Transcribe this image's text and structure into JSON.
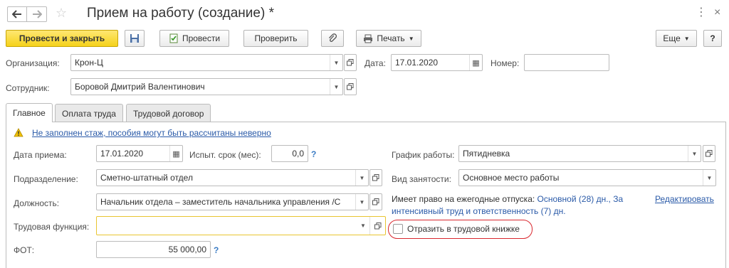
{
  "window": {
    "title": "Прием на работу (создание) *"
  },
  "toolbar": {
    "post_close_label": "Провести и закрыть",
    "post_label": "Провести",
    "check_label": "Проверить",
    "print_label": "Печать",
    "more_label": "Еще",
    "help_label": "?"
  },
  "header": {
    "org_label": "Организация:",
    "org_value": "Крон-Ц",
    "date_label": "Дата:",
    "date_value": "17.01.2020",
    "number_label": "Номер:",
    "number_value": "",
    "employee_label": "Сотрудник:",
    "employee_value": "Боровой Дмитрий Валентинович"
  },
  "tabs": [
    {
      "label": "Главное"
    },
    {
      "label": "Оплата труда"
    },
    {
      "label": "Трудовой договор"
    }
  ],
  "main": {
    "warning_text": "Не заполнен стаж, пособия могут быть рассчитаны неверно",
    "hire_date_label": "Дата приема:",
    "hire_date_value": "17.01.2020",
    "probation_label": "Испыт. срок (мес):",
    "probation_value": "0,0",
    "question_mark": "?",
    "department_label": "Подразделение:",
    "department_value": "Сметно-штатный отдел",
    "position_label": "Должность:",
    "position_value": "Начальник отдела – заместитель начальника управления /С",
    "labor_function_label": "Трудовая функция:",
    "labor_function_value": "",
    "fot_label": "ФОТ:",
    "fot_value": "55 000,00",
    "schedule_label": "График работы:",
    "schedule_value": "Пятидневка",
    "employment_type_label": "Вид занятости:",
    "employment_type_value": "Основное место работы",
    "vacation_prefix": "Имеет право на ежегодные отпуска:",
    "vacation_line1_rest": "Основной (28) дн., За",
    "vacation_line2": "интенсивный труд и ответственность (7) дн.",
    "edit_link": "Редактировать",
    "labor_book_label": "Отразить в трудовой книжке"
  },
  "colors": {
    "primary_button": "#f5d21b",
    "link": "#2a5aa8",
    "highlight_circle": "#d9272e",
    "focus_border": "#e8c531"
  }
}
